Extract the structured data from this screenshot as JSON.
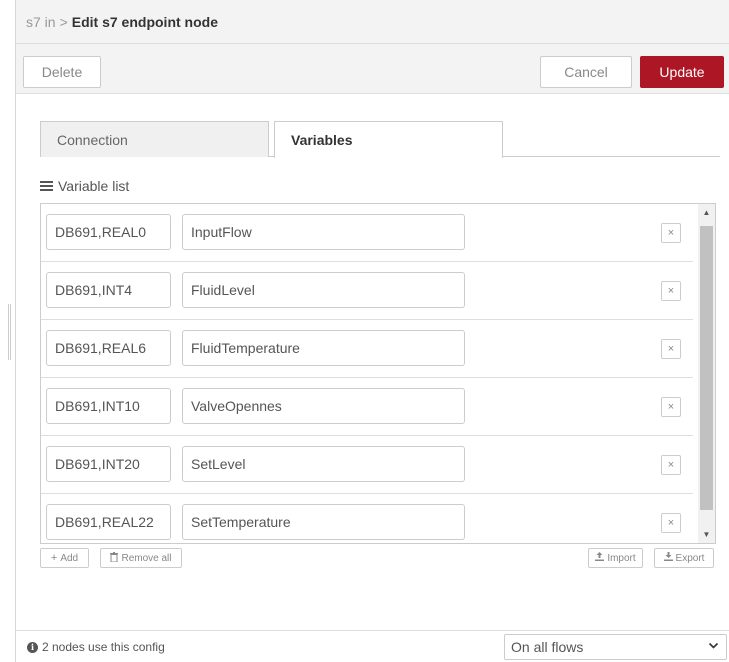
{
  "breadcrumb": {
    "parent": "s7 in",
    "separator": ">",
    "title": "Edit s7 endpoint node"
  },
  "toolbar": {
    "delete_label": "Delete",
    "cancel_label": "Cancel",
    "update_label": "Update"
  },
  "tabs": [
    {
      "label": "Connection",
      "active": false
    },
    {
      "label": "Variables",
      "active": true
    }
  ],
  "variable_list": {
    "label": "Variable list",
    "rows": [
      {
        "address": "DB691,REAL0",
        "name": "InputFlow"
      },
      {
        "address": "DB691,INT4",
        "name": "FluidLevel"
      },
      {
        "address": "DB691,REAL6",
        "name": "FluidTemperature"
      },
      {
        "address": "DB691,INT10",
        "name": "ValveOpennes"
      },
      {
        "address": "DB691,INT20",
        "name": "SetLevel"
      },
      {
        "address": "DB691,REAL22",
        "name": "SetTemperature"
      }
    ],
    "remove_glyph": "×"
  },
  "list_buttons": {
    "add_label": "Add",
    "remove_all_label": "Remove all",
    "import_label": "Import",
    "export_label": "Export"
  },
  "footer": {
    "info_text": "2 nodes use this config",
    "scope_value": "On all flows"
  },
  "colors": {
    "accent": "#ad1625"
  }
}
